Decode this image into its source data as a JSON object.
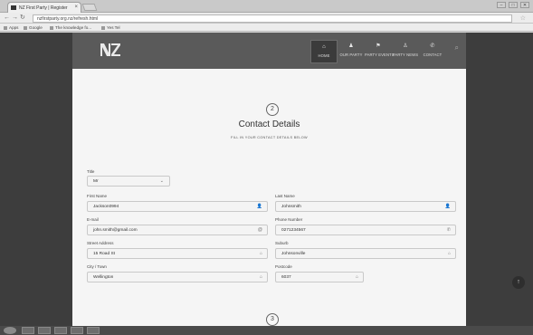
{
  "browser": {
    "tab_title": "NZ First Party | Register",
    "tab_close": "×",
    "url": "nzfirstparty.org.nz/refresh.html",
    "bookmarks": [
      "Apps",
      "Google",
      "The knowledge fo...",
      "Yes Tel"
    ]
  },
  "header": {
    "nav": [
      {
        "label": "HOME",
        "icon": "home-icon",
        "active": true
      },
      {
        "label": "OUR PARTY",
        "icon": "people-icon",
        "active": false
      },
      {
        "label": "PARTY EVENTS",
        "icon": "flag-icon",
        "active": false
      },
      {
        "label": "PARTY NEWS",
        "icon": "news-icon",
        "active": false
      },
      {
        "label": "CONTACT",
        "icon": "phone-icon",
        "active": false
      }
    ]
  },
  "form": {
    "step_current": "2",
    "step_next": "3",
    "title": "Contact Details",
    "subtitle": "FILL IN YOUR CONTACT DETAILS BELOW",
    "title_label": "Title",
    "title_value": "Mr",
    "first_name_label": "First Name",
    "first_name_value": "Jackson0994",
    "last_name_label": "Last Name",
    "last_name_value": "Johnsmith",
    "email_label": "E-mail",
    "email_value": "john.smith@gmail.com",
    "phone_label": "Phone Number",
    "phone_value": "0271234567",
    "street_label": "Street Address",
    "street_value": "15 Road St",
    "suburb_label": "Suburb",
    "suburb_value": "Johnsonville",
    "city_label": "City / Town",
    "city_value": "Wellington",
    "postcode_label": "Postcode",
    "postcode_value": "6037"
  },
  "icon_glyphs": {
    "user": "👤",
    "email": "@",
    "phone": "✆",
    "location": "⌂",
    "chevron": "⌄",
    "up": "↑",
    "search": "⌕"
  }
}
